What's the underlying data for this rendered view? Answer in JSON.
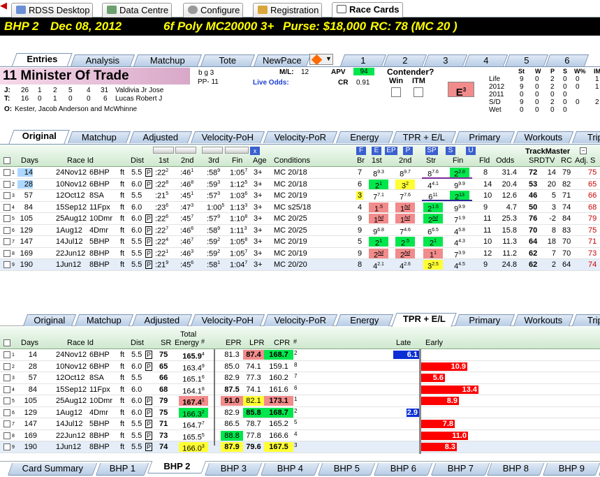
{
  "top_tabs": [
    "RDSS Desktop",
    "Data Centre",
    "Configure",
    "Registration",
    "Race Cards"
  ],
  "race_header": {
    "race": "BHP  2",
    "date": "Dec 08, 2012",
    "cond": "6f  Poly  MC20000  3+",
    "purse": "Purse: $18,000",
    "rc": "RC: 78  (MC 20 )"
  },
  "entry_tabs": [
    "Entries",
    "Analysis",
    "Matchup",
    "Tote",
    "NewPace"
  ],
  "num_tabs": [
    "1",
    "2",
    "3",
    "4",
    "5",
    "6"
  ],
  "horse": {
    "num_name": "11  Minister Of Trade",
    "sex": "b g 3",
    "pp": "PP- 11",
    "ml_label": "M/L:",
    "ml": "12",
    "live_odds": "Live Odds:",
    "apv_label": "APV",
    "apv": "94",
    "cr_label": "CR",
    "cr": "0.91",
    "contender": "Contender?",
    "win": "Win",
    "itm": "ITM",
    "e3": "E",
    "e3sup": "3"
  },
  "jt": {
    "j_label": "J:",
    "j_stats": [
      "26",
      "1",
      "2",
      "5",
      "4",
      "31"
    ],
    "jockey": "Valdivia Jr Jose",
    "t_label": "T:",
    "t_stats": [
      "16",
      "0",
      "1",
      "0",
      "0",
      "6"
    ],
    "trainer": "Lucas Robert J",
    "o_label": "O:",
    "owner": "Kester, Jacob Anderson and McWhinne"
  },
  "record": {
    "headers": [
      "St",
      "W",
      "P",
      "S",
      "W%",
      "IM"
    ],
    "rows": [
      [
        "Life",
        "9",
        "0",
        "2",
        "0",
        "0",
        "1"
      ],
      [
        "2012",
        "9",
        "0",
        "2",
        "0",
        "0",
        "1"
      ],
      [
        "2011",
        "0",
        "0",
        "0",
        "0",
        "",
        ""
      ],
      [
        "S/D",
        "9",
        "0",
        "2",
        "0",
        "0",
        "2"
      ],
      [
        "Wet",
        "0",
        "0",
        "0",
        "0",
        "",
        ""
      ]
    ]
  },
  "mid_tabs": [
    "Original",
    "Matchup",
    "Adjusted",
    "Velocity-PoH",
    "Velocity-PoR",
    "Energy",
    "TPR + E/L",
    "Primary",
    "Workouts",
    "Trip"
  ],
  "pp_header": {
    "days": "Days",
    "race_id": "Race Id",
    "dist": "Dist",
    "c1": "1st",
    "c2": "2nd",
    "c3": "3rd",
    "fin": "Fin",
    "age": "Age",
    "cond": "Conditions",
    "br": "Br",
    "s1": "1st",
    "s2": "2nd",
    "str": "Str",
    "f": "Fin",
    "fld": "Fld",
    "odds": "Odds",
    "tm": "TrackMaster",
    "srdtv": "SRDTV",
    "rc": "RC",
    "adj": "Adj. S",
    "btn": [
      "F",
      "E",
      "EP",
      "P",
      "SP",
      "S",
      "U"
    ],
    "x": "x"
  },
  "pp_rows": [
    {
      "n": "1",
      "days": "14",
      "date": "24Nov12",
      "race": "6BHP",
      "surf": "ft",
      "dist": "5.5",
      "p": "P",
      "c1": ":22",
      "c1s": "2",
      "c2": ":46",
      "c2s": "1",
      "c3": ":58",
      "c3s": "9",
      "fin": "1:05",
      "fins": "7",
      "age": "3+",
      "cond": "MC 20/18",
      "br": "7",
      "s1": "8",
      "s1s": "9.3",
      "s2": "8",
      "s2s": "9.7",
      "str": "8",
      "strs": "7.6",
      "f": "2",
      "fs": "2.8",
      "fld": "8",
      "odds": "31.4",
      "sr": "72",
      "dt": "14",
      "rc": "79",
      "adj": "75"
    },
    {
      "n": "2",
      "days": "28",
      "date": "10Nov12",
      "race": "6BHP",
      "surf": "ft",
      "dist": "6.0",
      "p": "P",
      "c1": ":22",
      "c1s": "8",
      "c2": ":46",
      "c2s": "8",
      "c3": ":59",
      "c3s": "3",
      "fin": "1:12",
      "fins": "5",
      "age": "3+",
      "cond": "MC 20/18",
      "br": "6",
      "s1": "2",
      "s1s": "1",
      "s2": "3",
      "s2s": "2",
      "str": "4",
      "strs": "4.1",
      "f": "9",
      "fs": "9.9",
      "fld": "14",
      "odds": "20.4",
      "sr": "53",
      "dt": "20",
      "rc": "82",
      "adj": "65"
    },
    {
      "n": "3",
      "days": "57",
      "date": "12Oct12",
      "race": "8SA",
      "surf": "ft",
      "dist": "5.5",
      "p": "",
      "c1": ":21",
      "c1s": "5",
      "c2": ":45",
      "c2s": "1",
      "c3": ":57",
      "c3s": "3",
      "fin": "1:03",
      "fins": "6",
      "age": "3+",
      "cond": "MC 20/19",
      "br": "3",
      "s1": "7",
      "s1s": "7.1",
      "s2": "7",
      "s2s": "7.6",
      "str": "6",
      "strs": "11",
      "f": "2",
      "fs": "13",
      "fld": "10",
      "odds": "12.6",
      "sr": "46",
      "dt": "5",
      "rc": "71",
      "adj": "66"
    },
    {
      "n": "4",
      "days": "84",
      "date": "15Sep12",
      "race": "11Fpx",
      "surf": "ft",
      "dist": "6.0",
      "p": "",
      "c1": ":23",
      "c1s": "6",
      "c2": ":47",
      "c2s": "3",
      "c3": "1:00",
      "c3s": "5",
      "fin": "1:13",
      "fins": "3",
      "age": "3+",
      "cond": "MC s25/18",
      "br": "4",
      "s1": "1",
      "s1s": ".5",
      "s2": "1",
      "s2s": "hd",
      "str": "2",
      "strs": "1.5",
      "f": "9",
      "fs": "9.9",
      "fld": "9",
      "odds": "4.7",
      "sr": "50",
      "dt": "3",
      "rc": "74",
      "adj": "68"
    },
    {
      "n": "5",
      "days": "105",
      "date": "25Aug12",
      "race": "10Dmr",
      "surf": "ft",
      "dist": "6.0",
      "p": "P",
      "c1": ":22",
      "c1s": "6",
      "c2": ":45",
      "c2s": "7",
      "c3": ":57",
      "c3s": "9",
      "fin": "1:10",
      "fins": "8",
      "age": "3+",
      "cond": "MC 20/25",
      "br": "9",
      "s1": "1",
      "s1s": "hd",
      "s2": "1",
      "s2s": "hd",
      "str": "2",
      "strs": "hd",
      "f": "7",
      "fs": "1.9",
      "fld": "11",
      "odds": "25.3",
      "sr": "76",
      "dt": "-2",
      "rc": "84",
      "adj": "79"
    },
    {
      "n": "6",
      "days": "129",
      "date": "1Aug12",
      "race": "4Dmr",
      "surf": "ft",
      "dist": "6.0",
      "p": "P",
      "c1": ":22",
      "c1s": "7",
      "c2": ":46",
      "c2s": "6",
      "c3": ":58",
      "c3s": "9",
      "fin": "1:11",
      "fins": "3",
      "age": "3+",
      "cond": "MC 20/25",
      "br": "9",
      "s1": "9",
      "s1s": "6.8",
      "s2": "7",
      "s2s": "4.6",
      "str": "6",
      "strs": "6.5",
      "f": "4",
      "fs": "5.8",
      "fld": "11",
      "odds": "15.8",
      "sr": "70",
      "dt": "8",
      "rc": "83",
      "adj": "75"
    },
    {
      "n": "7",
      "days": "147",
      "date": "14Jul12",
      "race": "5BHP",
      "surf": "ft",
      "dist": "5.5",
      "p": "P",
      "c1": ":22",
      "c1s": "4",
      "c2": ":46",
      "c2s": "7",
      "c3": ":59",
      "c3s": "2",
      "fin": "1:05",
      "fins": "8",
      "age": "3+",
      "cond": "MC 20/19",
      "br": "5",
      "s1": "2",
      "s1s": "1",
      "s2": "2",
      "s2s": ".5",
      "str": "2",
      "strs": "1",
      "f": "4",
      "fs": "4.3",
      "fld": "10",
      "odds": "11.3",
      "sr": "64",
      "dt": "18",
      "rc": "70",
      "adj": "71"
    },
    {
      "n": "8",
      "days": "169",
      "date": "22Jun12",
      "race": "8BHP",
      "surf": "ft",
      "dist": "5.5",
      "p": "P",
      "c1": ":22",
      "c1s": "1",
      "c2": ":46",
      "c2s": "3",
      "c3": ":59",
      "c3s": "2",
      "fin": "1:05",
      "fins": "7",
      "age": "3+",
      "cond": "MC 20/19",
      "br": "9",
      "s1": "2",
      "s1s": "hd",
      "s2": "2",
      "s2s": "hd",
      "str": "1",
      "strs": "1",
      "f": "7",
      "fs": "3.9",
      "fld": "12",
      "odds": "11.2",
      "sr": "62",
      "dt": "7",
      "rc": "70",
      "adj": "73"
    },
    {
      "n": "9",
      "days": "190",
      "date": "1Jun12",
      "race": "8BHP",
      "surf": "ft",
      "dist": "5.5",
      "p": "P",
      "c1": ":21",
      "c1s": "9",
      "c2": ":45",
      "c2s": "6",
      "c3": ":58",
      "c3s": "1",
      "fin": "1:04",
      "fins": "7",
      "age": "3+",
      "cond": "MC 20/20",
      "br": "8",
      "s1": "4",
      "s1s": "2.1",
      "s2": "4",
      "s2s": "2.6",
      "str": "3",
      "strs": "2.5",
      "f": "4",
      "fs": "4.5",
      "fld": "9",
      "odds": "24.8",
      "sr": "62",
      "dt": "2",
      "rc": "64",
      "adj": "74"
    }
  ],
  "tpr_header": {
    "days": "Days",
    "race_id": "Race Id",
    "dist": "Dist",
    "sr": "SR",
    "te1": "Total",
    "te2": "Energy",
    "hash": "#",
    "epr": "EPR",
    "lpr": "LPR",
    "cpr": "CPR",
    "hash2": "#",
    "late": "Late",
    "early": "Early"
  },
  "tpr_rows": [
    {
      "n": "1",
      "days": "14",
      "date": "24Nov12",
      "race": "6BHP",
      "surf": "ft",
      "dist": "5.5",
      "p": "P",
      "sr": "75",
      "te": "165.9",
      "ter": "4",
      "epr": "81.3",
      "lpr": "87.4",
      "cpr": "168.7",
      "cr": "2",
      "bar": "6.1"
    },
    {
      "n": "2",
      "days": "28",
      "date": "10Nov12",
      "race": "6BHP",
      "surf": "ft",
      "dist": "6.0",
      "p": "P",
      "sr": "65",
      "te": "163.4",
      "ter": "9",
      "epr": "85.0",
      "lpr": "74.1",
      "cpr": "159.1",
      "cr": "8",
      "bar": "10.9"
    },
    {
      "n": "3",
      "days": "57",
      "date": "12Oct12",
      "race": "8SA",
      "surf": "ft",
      "dist": "5.5",
      "p": "",
      "sr": "66",
      "te": "165.1",
      "ter": "6",
      "epr": "82.9",
      "lpr": "77.3",
      "cpr": "160.2",
      "cr": "7",
      "bar": "5.6"
    },
    {
      "n": "4",
      "days": "84",
      "date": "15Sep12",
      "race": "11Fpx",
      "surf": "ft",
      "dist": "6.0",
      "p": "",
      "sr": "68",
      "te": "164.1",
      "ter": "8",
      "epr": "87.5",
      "lpr": "74.1",
      "cpr": "161.6",
      "cr": "6",
      "bar": "13.4"
    },
    {
      "n": "5",
      "days": "105",
      "date": "25Aug12",
      "race": "10Dmr",
      "surf": "ft",
      "dist": "6.0",
      "p": "P",
      "sr": "79",
      "te": "167.4",
      "ter": "1",
      "epr": "91.0",
      "lpr": "82.1",
      "cpr": "173.1",
      "cr": "1",
      "bar": "8.9"
    },
    {
      "n": "6",
      "days": "129",
      "date": "1Aug12",
      "race": "4Dmr",
      "surf": "ft",
      "dist": "6.0",
      "p": "P",
      "sr": "75",
      "te": "166.3",
      "ter": "2",
      "epr": "82.9",
      "lpr": "85.8",
      "cpr": "168.7",
      "cr": "2",
      "bar": "2.9"
    },
    {
      "n": "7",
      "days": "147",
      "date": "14Jul12",
      "race": "5BHP",
      "surf": "ft",
      "dist": "5.5",
      "p": "P",
      "sr": "71",
      "te": "164.7",
      "ter": "7",
      "epr": "86.5",
      "lpr": "78.7",
      "cpr": "165.2",
      "cr": "5",
      "bar": "7.8"
    },
    {
      "n": "8",
      "days": "169",
      "date": "22Jun12",
      "race": "8BHP",
      "surf": "ft",
      "dist": "5.5",
      "p": "P",
      "sr": "73",
      "te": "165.5",
      "ter": "5",
      "epr": "88.8",
      "lpr": "77.8",
      "cpr": "166.6",
      "cr": "4",
      "bar": "11.0"
    },
    {
      "n": "9",
      "days": "190",
      "date": "1Jun12",
      "race": "8BHP",
      "surf": "ft",
      "dist": "5.5",
      "p": "P",
      "sr": "74",
      "te": "166.0",
      "ter": "3",
      "epr": "87.9",
      "lpr": "79.6",
      "cpr": "167.5",
      "cr": "3",
      "bar": "8.3"
    }
  ],
  "bottom_tabs": [
    "Card Summary",
    "BHP 1",
    "BHP 2",
    "BHP 3",
    "BHP 4",
    "BHP 5",
    "BHP 6",
    "BHP 7",
    "BHP 8",
    "BHP 9",
    "BH"
  ],
  "colors": {
    "green": "#00e64d",
    "red": "#f28b8b",
    "yellow": "#ffff33",
    "bar_red": "#ff0000",
    "bar_blue": "#0a2fd6"
  }
}
